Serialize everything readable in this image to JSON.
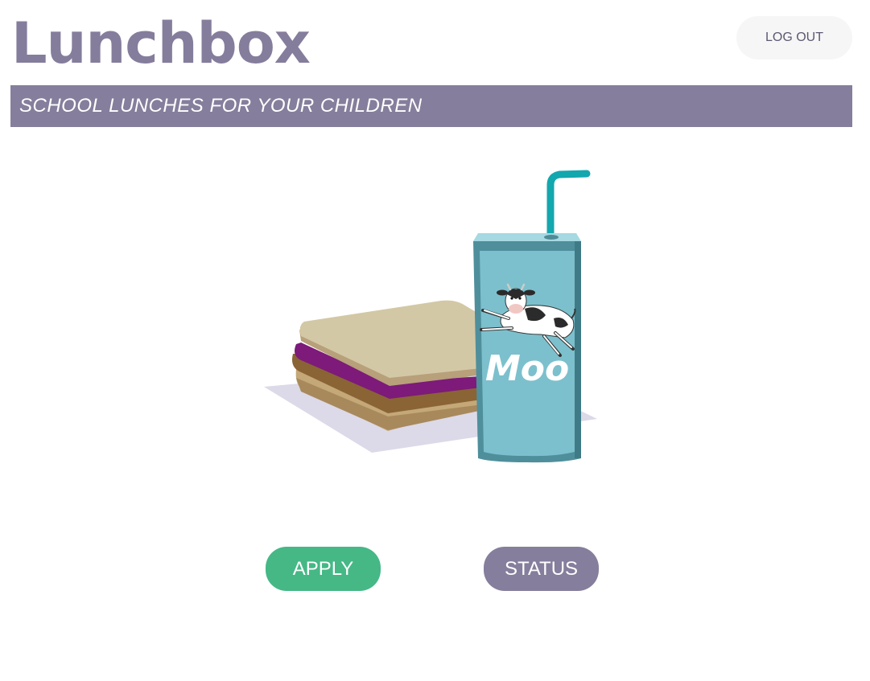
{
  "header": {
    "app_title": "Lunchbox",
    "logout_label": "LOG OUT"
  },
  "banner": {
    "tagline": "SCHOOL LUNCHES FOR YOUR CHILDREN"
  },
  "illustration": {
    "carton_label": "Moo",
    "icons": [
      "sandwich-icon",
      "milk-carton-icon",
      "cow-icon"
    ]
  },
  "actions": {
    "apply_label": "APPLY",
    "status_label": "STATUS"
  },
  "colors": {
    "brand_purple": "#857e9c",
    "apply_green": "#45b886",
    "carton_blue": "#7cc0cd",
    "straw_teal": "#13a7ae",
    "jelly_purple": "#7d1a7a"
  }
}
